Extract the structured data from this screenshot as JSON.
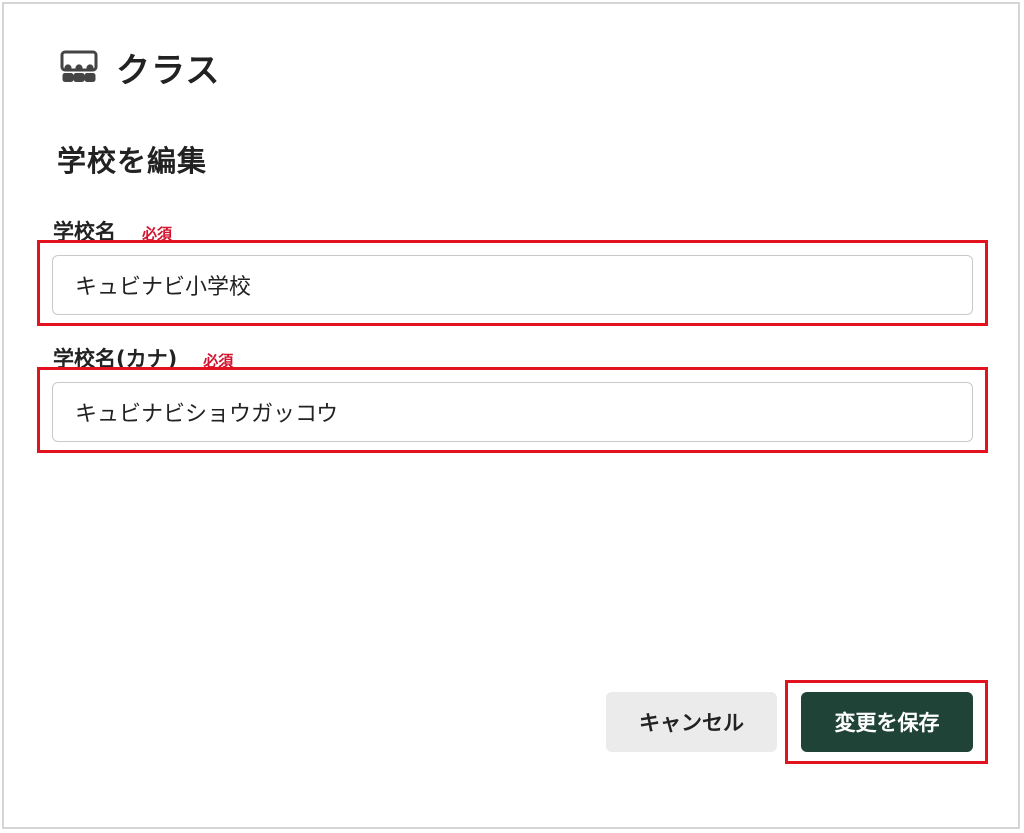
{
  "header": {
    "icon": "classroom-icon",
    "title": "クラス"
  },
  "section_title": "学校を編集",
  "form": {
    "school_name": {
      "label": "学校名",
      "required": "必須",
      "value": "キュビナビ小学校"
    },
    "school_name_kana": {
      "label": "学校名(カナ)",
      "required": "必須",
      "value": "キュビナビショウガッコウ"
    }
  },
  "actions": {
    "cancel_label": "キャンセル",
    "save_label": "変更を保存"
  },
  "colors": {
    "required": "#d2122e",
    "primary": "#1f4437",
    "highlight": "#e3121f"
  }
}
